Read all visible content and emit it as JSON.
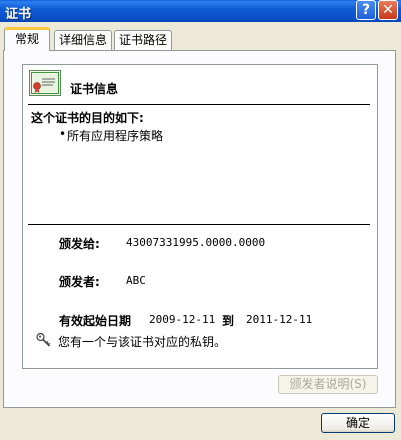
{
  "window": {
    "title": "证书"
  },
  "tabs": [
    {
      "label": "常规",
      "active": true
    },
    {
      "label": "详细信息",
      "active": false
    },
    {
      "label": "证书路径",
      "active": false
    }
  ],
  "certificate": {
    "header": "证书信息",
    "purpose_heading": "这个证书的目的如下:",
    "purposes": [
      "所有应用程序策略"
    ],
    "issued_to_label": "颁发给:",
    "issued_to_value": "43007331995.0000.0000",
    "issued_by_label": "颁发者:",
    "issued_by_value": "ABC",
    "valid_from_label": "有效起始日期",
    "valid_from_value": "2009-12-11",
    "valid_to_label": "到",
    "valid_to_value": "2011-12-11",
    "private_key_note": "您有一个与该证书对应的私钥。"
  },
  "buttons": {
    "issuer_statement": "颁发者说明(S)",
    "ok": "确定"
  },
  "icons": {
    "help": "help-icon",
    "close": "close-icon",
    "certificate": "certificate-icon",
    "key": "key-icon"
  }
}
